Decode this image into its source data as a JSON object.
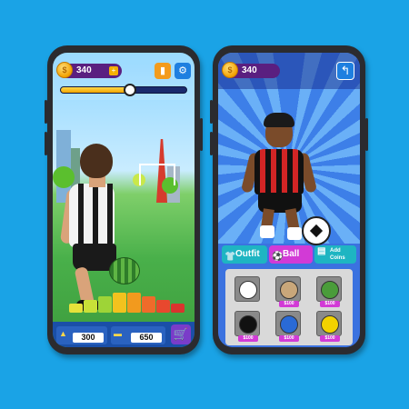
{
  "left_phone": {
    "hud": {
      "coins": "340",
      "progress_fraction": 0.55,
      "stats_icon": "bar-chart-icon",
      "settings_icon": "gear-icon"
    },
    "bottom": {
      "score_left_value": "300",
      "score_right_value": "650",
      "cart_icon": "cart-icon"
    }
  },
  "right_phone": {
    "hud": {
      "coins": "340",
      "back_icon": "back-arrow-icon"
    },
    "tabs": {
      "outfit_label": "Outfit",
      "ball_label": "Ball",
      "coins_label_line1": "Add",
      "coins_label_line2": "Coins"
    },
    "items": [
      {
        "name": "classic-ball",
        "price": "",
        "color": "#ffffff"
      },
      {
        "name": "patterned-ball",
        "price": "$100",
        "color": "#c9a77a"
      },
      {
        "name": "watermelon-ball",
        "price": "$100",
        "color": "#4a9c3a"
      },
      {
        "name": "eight-ball",
        "price": "$100",
        "color": "#111111"
      },
      {
        "name": "earth-ball",
        "price": "$100",
        "color": "#2a6ad6"
      },
      {
        "name": "nine-ball",
        "price": "$100",
        "color": "#f2d200"
      }
    ]
  },
  "colors": {
    "background": "#1aa3e6",
    "accent_purple": "#d23ad6",
    "accent_teal": "#1eb5c2"
  }
}
